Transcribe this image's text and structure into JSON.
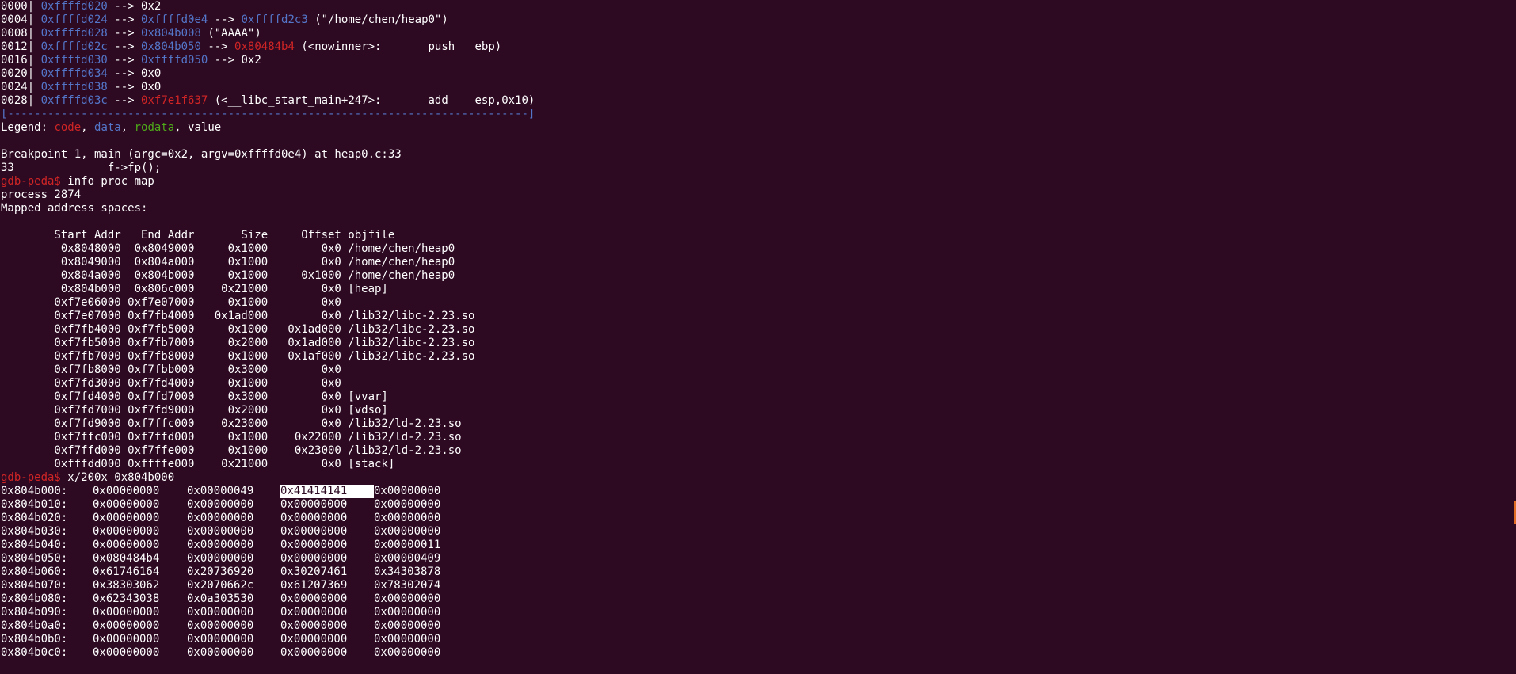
{
  "stack": [
    [
      {
        "t": "0000| "
      },
      {
        "t": "0xffffd020",
        "c": "blue"
      },
      {
        "t": " --> 0x2"
      }
    ],
    [
      {
        "t": "0004| "
      },
      {
        "t": "0xffffd024",
        "c": "blue"
      },
      {
        "t": " --> "
      },
      {
        "t": "0xffffd0e4",
        "c": "blue"
      },
      {
        "t": " --> "
      },
      {
        "t": "0xffffd2c3",
        "c": "blue"
      },
      {
        "t": " (\"/home/chen/heap0\")"
      }
    ],
    [
      {
        "t": "0008| "
      },
      {
        "t": "0xffffd028",
        "c": "blue"
      },
      {
        "t": " --> "
      },
      {
        "t": "0x804b008",
        "c": "blue"
      },
      {
        "t": " (\"AAAA\")"
      }
    ],
    [
      {
        "t": "0012| "
      },
      {
        "t": "0xffffd02c",
        "c": "blue"
      },
      {
        "t": " --> "
      },
      {
        "t": "0x804b050",
        "c": "blue"
      },
      {
        "t": " --> "
      },
      {
        "t": "0x80484b4",
        "c": "red"
      },
      {
        "t": " (<nowinner>:       push   ebp)"
      }
    ],
    [
      {
        "t": "0016| "
      },
      {
        "t": "0xffffd030",
        "c": "blue"
      },
      {
        "t": " --> "
      },
      {
        "t": "0xffffd050",
        "c": "blue"
      },
      {
        "t": " --> 0x2"
      }
    ],
    [
      {
        "t": "0020| "
      },
      {
        "t": "0xffffd034",
        "c": "blue"
      },
      {
        "t": " --> 0x0"
      }
    ],
    [
      {
        "t": "0024| "
      },
      {
        "t": "0xffffd038",
        "c": "blue"
      },
      {
        "t": " --> 0x0"
      }
    ],
    [
      {
        "t": "0028| "
      },
      {
        "t": "0xffffd03c",
        "c": "blue"
      },
      {
        "t": " --> "
      },
      {
        "t": "0xf7e1f637",
        "c": "red"
      },
      {
        "t": " (<__libc_start_main+247>:       add    esp,0x10)"
      }
    ]
  ],
  "separator": "[------------------------------------------------------------------------------]",
  "legend": [
    {
      "t": "Legend: "
    },
    {
      "t": "code",
      "c": "red"
    },
    {
      "t": ", "
    },
    {
      "t": "data",
      "c": "blue"
    },
    {
      "t": ", "
    },
    {
      "t": "rodata",
      "c": "green"
    },
    {
      "t": ", value"
    }
  ],
  "breakpoint": "Breakpoint 1, main (argc=0x2, argv=0xffffd0e4) at heap0.c:33",
  "source_line": "33              f->fp();",
  "prompt": "gdb-peda$",
  "cmd_procmap": " info proc map",
  "process": "process 2874",
  "mapped_title": "Mapped address spaces:",
  "map_header": "        Start Addr   End Addr       Size     Offset objfile",
  "map_rows": [
    "         0x8048000  0x8049000     0x1000        0x0 /home/chen/heap0",
    "         0x8049000  0x804a000     0x1000        0x0 /home/chen/heap0",
    "         0x804a000  0x804b000     0x1000     0x1000 /home/chen/heap0",
    "         0x804b000  0x806c000    0x21000        0x0 [heap]",
    "        0xf7e06000 0xf7e07000     0x1000        0x0",
    "        0xf7e07000 0xf7fb4000   0x1ad000        0x0 /lib32/libc-2.23.so",
    "        0xf7fb4000 0xf7fb5000     0x1000   0x1ad000 /lib32/libc-2.23.so",
    "        0xf7fb5000 0xf7fb7000     0x2000   0x1ad000 /lib32/libc-2.23.so",
    "        0xf7fb7000 0xf7fb8000     0x1000   0x1af000 /lib32/libc-2.23.so",
    "        0xf7fb8000 0xf7fbb000     0x3000        0x0",
    "        0xf7fd3000 0xf7fd4000     0x1000        0x0",
    "        0xf7fd4000 0xf7fd7000     0x3000        0x0 [vvar]",
    "        0xf7fd7000 0xf7fd9000     0x2000        0x0 [vdso]",
    "        0xf7fd9000 0xf7ffc000    0x23000        0x0 /lib32/ld-2.23.so",
    "        0xf7ffc000 0xf7ffd000     0x1000    0x22000 /lib32/ld-2.23.so",
    "        0xf7ffd000 0xf7ffe000     0x1000    0x23000 /lib32/ld-2.23.so",
    "        0xfffdd000 0xffffe000    0x21000        0x0 [stack]"
  ],
  "cmd_x": " x/200x 0x804b000",
  "hex_rows": [
    [
      "0x804b000:",
      "0x00000000",
      "0x00000049",
      "0x41414141",
      "0x00000000"
    ],
    [
      "0x804b010:",
      "0x00000000",
      "0x00000000",
      "0x00000000",
      "0x00000000"
    ],
    [
      "0x804b020:",
      "0x00000000",
      "0x00000000",
      "0x00000000",
      "0x00000000"
    ],
    [
      "0x804b030:",
      "0x00000000",
      "0x00000000",
      "0x00000000",
      "0x00000000"
    ],
    [
      "0x804b040:",
      "0x00000000",
      "0x00000000",
      "0x00000000",
      "0x00000011"
    ],
    [
      "0x804b050:",
      "0x080484b4",
      "0x00000000",
      "0x00000000",
      "0x00000409"
    ],
    [
      "0x804b060:",
      "0x61746164",
      "0x20736920",
      "0x30207461",
      "0x34303878"
    ],
    [
      "0x804b070:",
      "0x38303062",
      "0x2070662c",
      "0x61207369",
      "0x78302074"
    ],
    [
      "0x804b080:",
      "0x62343038",
      "0x0a303530",
      "0x00000000",
      "0x00000000"
    ],
    [
      "0x804b090:",
      "0x00000000",
      "0x00000000",
      "0x00000000",
      "0x00000000"
    ],
    [
      "0x804b0a0:",
      "0x00000000",
      "0x00000000",
      "0x00000000",
      "0x00000000"
    ],
    [
      "0x804b0b0:",
      "0x00000000",
      "0x00000000",
      "0x00000000",
      "0x00000000"
    ],
    [
      "0x804b0c0:",
      "0x00000000",
      "0x00000000",
      "0x00000000",
      "0x00000000"
    ]
  ],
  "selected_cell": {
    "row": 0,
    "col": 3
  },
  "colors": {
    "background": "#2d0922",
    "foreground": "#ffffff",
    "code": "#d02525",
    "data": "#5476c9",
    "rodata": "#4ea91a",
    "selection": "#ffffff"
  }
}
